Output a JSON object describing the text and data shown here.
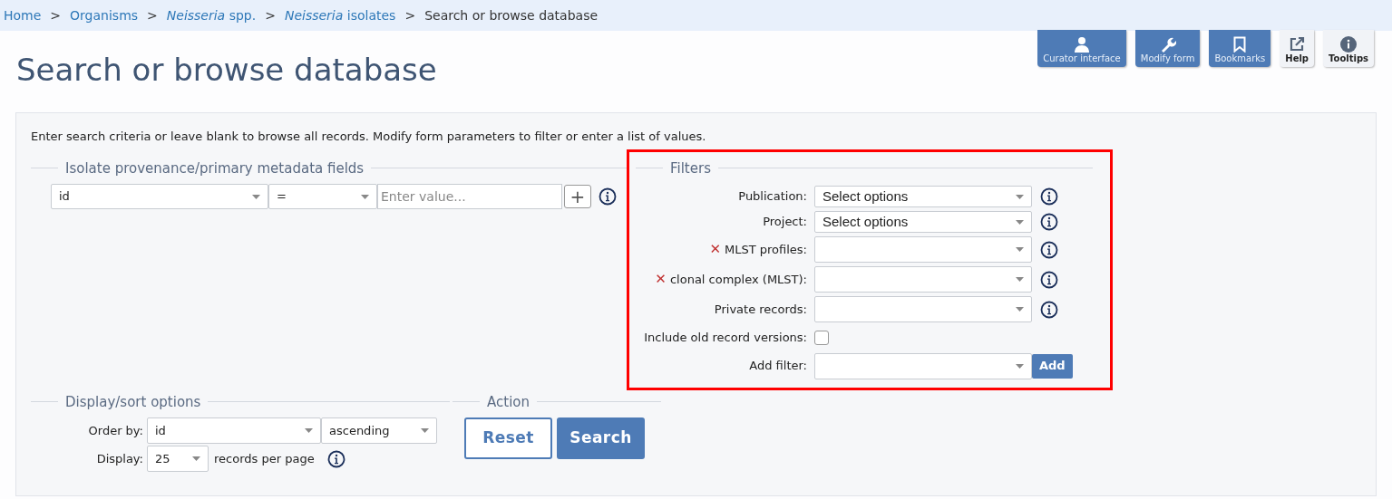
{
  "breadcrumb": [
    {
      "text": "Home",
      "link": true
    },
    {
      "separator": ">",
      "text": "Organisms",
      "link": true
    },
    {
      "separator": ">",
      "text": "*Neisseria* spp.",
      "link": true
    },
    {
      "separator": ">",
      "text": "*Neisseria* isolates",
      "link": true
    },
    {
      "separator": ">",
      "text": "Search or browse database",
      "link": false
    }
  ],
  "title": "Search or browse database",
  "toolbar": [
    {
      "kind": "curator",
      "label": "Curator interface"
    },
    {
      "kind": "wrench",
      "label": "Modify form"
    },
    {
      "kind": "bookmark",
      "label": "Bookmarks"
    },
    {
      "kind": "external",
      "label": "Help"
    },
    {
      "kind": "info",
      "label": "Tooltips"
    }
  ],
  "intro": "Enter search criteria or leave blank to browse all records. Modify form parameters to filter or enter a list of values.",
  "provenance": {
    "legend": "Isolate provenance/primary metadata fields",
    "field": "id",
    "operator": "=",
    "placeholder": "Enter value...",
    "add_button": "+"
  },
  "filters": {
    "legend": "Filters",
    "highlighted": true,
    "rows": [
      {
        "kind": "select",
        "label": "Publication:",
        "value": "Select options"
      },
      {
        "kind": "select",
        "label": "Project:",
        "value": "Select options"
      },
      {
        "kind": "select",
        "remove_icon": "✕",
        "label": "MLST profiles:"
      },
      {
        "kind": "select",
        "remove_icon": "✕",
        "label": "clonal complex (MLST):"
      },
      {
        "kind": "select",
        "label": "Private records:"
      },
      {
        "kind": "checkbox",
        "label": "Include old record versions:",
        "checked": false
      },
      {
        "kind": "add",
        "label": "Add filter:",
        "button": "Add"
      }
    ]
  },
  "display": {
    "legend": "Display/sort options",
    "order_label": "Order by:",
    "order_field": "id",
    "order_direction": "ascending",
    "display_label": "Display:",
    "per_page": "25",
    "per_page_suffix": "records per page"
  },
  "action": {
    "legend": "Action",
    "buttons": [
      {
        "kind": "reset",
        "label": "Reset"
      },
      {
        "kind": "search",
        "label": "Search"
      }
    ]
  }
}
